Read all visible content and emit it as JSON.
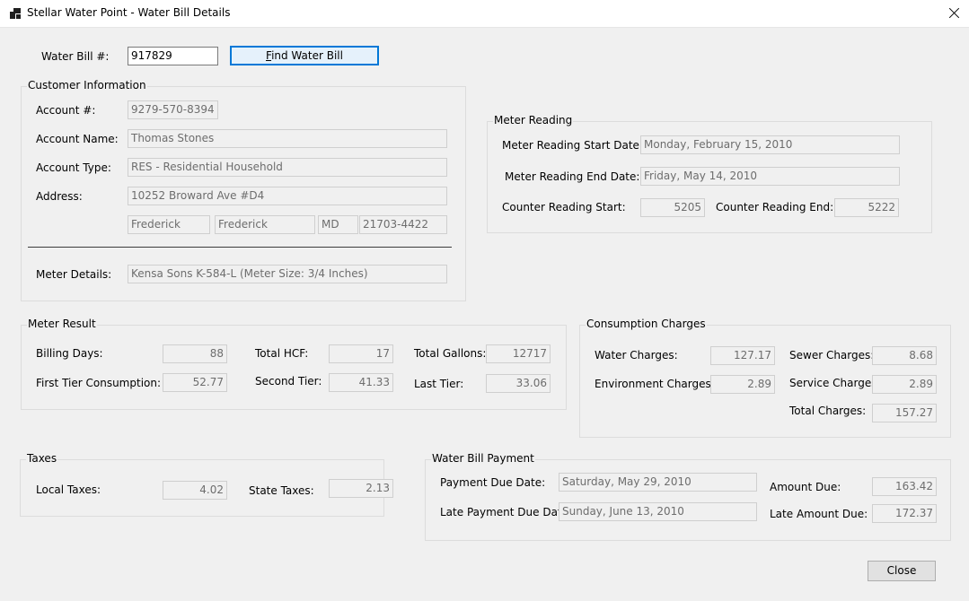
{
  "window": {
    "title": "Stellar Water Point - Water Bill Details",
    "icon": "app-window-icon",
    "close_icon": "close-icon"
  },
  "search": {
    "label": "Water Bill #:",
    "value": "917829",
    "button_label": "Find Water Bill"
  },
  "customer": {
    "group_title": "Customer Information",
    "account_number_label": "Account #:",
    "account_number": "9279-570-8394",
    "account_name_label": "Account Name:",
    "account_name": "Thomas Stones",
    "account_type_label": "Account Type:",
    "account_type": "RES - Residential Household",
    "address_label": "Address:",
    "address": "10252 Broward Ave #D4",
    "city": "Frederick",
    "county": "Frederick",
    "state": "MD",
    "zip": "21703-4422",
    "meter_details_label": "Meter Details:",
    "meter_details": "Kensa Sons K-584-L (Meter Size: 3/4 Inches)"
  },
  "meter_reading": {
    "group_title": "Meter Reading",
    "start_date_label": "Meter Reading Start Date:",
    "start_date": "Monday, February 15, 2010",
    "end_date_label": "Meter Reading End Date:",
    "end_date": "Friday, May 14, 2010",
    "counter_start_label": "Counter Reading Start:",
    "counter_start": "5205",
    "counter_end_label": "Counter Reading End:",
    "counter_end": "5222"
  },
  "meter_result": {
    "group_title": "Meter Result",
    "billing_days_label": "Billing Days:",
    "billing_days": "88",
    "total_hcf_label": "Total HCF:",
    "total_hcf": "17",
    "total_gallons_label": "Total Gallons:",
    "total_gallons": "12717",
    "first_tier_label": "First Tier Consumption:",
    "first_tier": "52.77",
    "second_tier_label": "Second Tier:",
    "second_tier": "41.33",
    "last_tier_label": "Last Tier:",
    "last_tier": "33.06"
  },
  "consumption": {
    "group_title": "Consumption Charges",
    "water_label": "Water Charges:",
    "water": "127.17",
    "sewer_label": "Sewer Charges:",
    "sewer": "8.68",
    "environment_label": "Environment Charges:",
    "environment": "2.89",
    "service_label": "Service Charges:",
    "service": "2.89",
    "total_label": "Total Charges:",
    "total": "157.27"
  },
  "taxes": {
    "group_title": "Taxes",
    "local_label": "Local Taxes:",
    "local": "4.02",
    "state_label": "State Taxes:",
    "state": "2.13"
  },
  "payment": {
    "group_title": "Water Bill Payment",
    "due_date_label": "Payment Due Date:",
    "due_date": "Saturday, May 29, 2010",
    "late_due_date_label": "Late Payment Due Date:",
    "late_due_date": "Sunday, June 13, 2010",
    "amount_due_label": "Amount Due:",
    "amount_due": "163.42",
    "late_amount_due_label": "Late Amount Due:",
    "late_amount_due": "172.37"
  },
  "footer": {
    "close_label": "Close"
  }
}
